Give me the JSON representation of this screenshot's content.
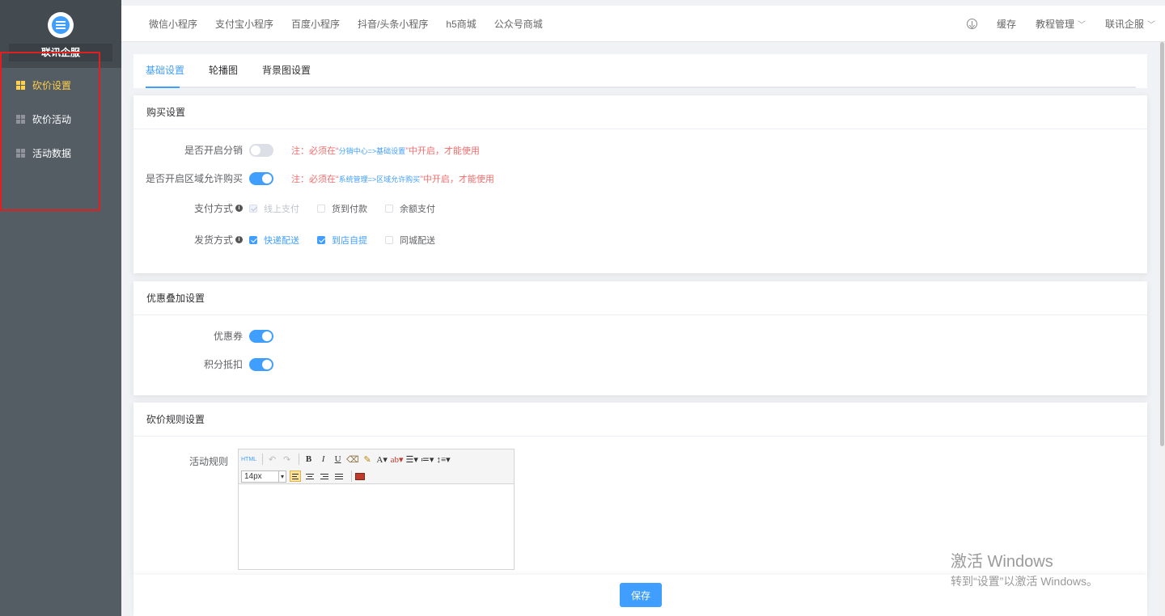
{
  "sidebar": {
    "brand": "联讯企服",
    "items": [
      {
        "label": "砍价设置"
      },
      {
        "label": "砍价活动"
      },
      {
        "label": "活动数据"
      }
    ]
  },
  "topnav": {
    "links": [
      "微信小程序",
      "支付宝小程序",
      "百度小程序",
      "抖音/头条小程序",
      "h5商城",
      "公众号商城"
    ],
    "cache": "缓存",
    "tutorial": "教程管理",
    "account": "联讯企服"
  },
  "tabs": [
    "基础设置",
    "轮播图",
    "背景图设置"
  ],
  "purchase": {
    "title": "购买设置",
    "distribution_label": "是否开启分销",
    "distribution_note_prefix": "注：必须在“",
    "distribution_note_link": "分销中心=>基础设置",
    "distribution_note_suffix": "”中开启，才能使用",
    "region_label": "是否开启区域允许购买",
    "region_note_prefix": "注：必须在“",
    "region_note_link": "系统管理=>区域允许购买",
    "region_note_suffix": "”中开启，才能使用",
    "pay_label": "支付方式",
    "pay_options": [
      "线上支付",
      "货到付款",
      "余额支付"
    ],
    "ship_label": "发货方式",
    "ship_options": [
      "快递配送",
      "到店自提",
      "同城配送"
    ]
  },
  "discount": {
    "title": "优惠叠加设置",
    "coupon_label": "优惠券",
    "points_label": "积分抵扣"
  },
  "rules": {
    "title": "砍价规则设置",
    "rule_label": "活动规则",
    "html_btn": "HTML",
    "font_size": "14px"
  },
  "save_label": "保存",
  "watermark": {
    "line1": "激活 Windows",
    "line2": "转到“设置”以激活 Windows。"
  },
  "colors": {
    "primary": "#409eff",
    "sidebar": "#545c64",
    "active_menu": "#ffd04b",
    "warning": "#f56c6c",
    "highlight_box": "#e02020"
  }
}
